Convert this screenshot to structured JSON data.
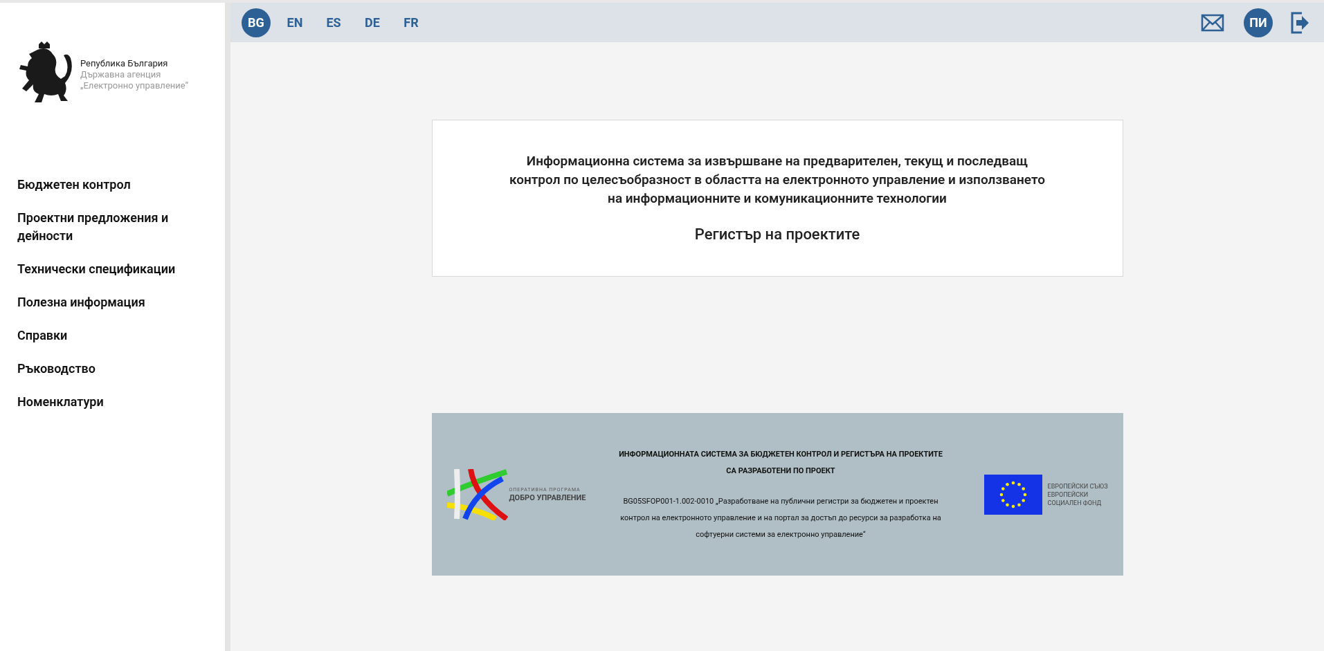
{
  "logo": {
    "line_1": "Република България",
    "line_2": "Държавна агенция",
    "line_3": "„Електронно управление“"
  },
  "sidebar": {
    "items": [
      {
        "label": "Бюджетен контрол"
      },
      {
        "label": "Проектни предложения и дейности"
      },
      {
        "label": "Технически спецификации"
      },
      {
        "label": "Полезна информация"
      },
      {
        "label": "Справки"
      },
      {
        "label": "Ръководство"
      },
      {
        "label": "Номенклатури"
      }
    ]
  },
  "languages": [
    {
      "label": "BG",
      "selected": true
    },
    {
      "label": "EN",
      "selected": false
    },
    {
      "label": "ES",
      "selected": false
    },
    {
      "label": "DE",
      "selected": false
    },
    {
      "label": "FR",
      "selected": false
    }
  ],
  "user": {
    "initials": "ПИ"
  },
  "intro": {
    "description": "Информационна система за извършване на предварителен, текущ и последващ контрол по целесъобразност в областта на електронното управление и използването на информационните и комуникационните технологии",
    "title": "Регистър на проектите"
  },
  "banner": {
    "program_caption": "ОПЕРАТИВНА ПРОГРАМА",
    "program_name": "ДОБРО УПРАВЛЕНИЕ",
    "heading_1": "ИНФОРМАЦИОННАТА СИСТЕМА ЗА БЮДЖЕТЕН КОНТРОЛ И РЕГИСТЪРА НА ПРОЕКТИТЕ",
    "heading_2": "СА РАЗРАБОТЕНИ ПО ПРОЕКТ",
    "project": "BG05SFOP001-1.002-0010 „Разработване на публични регистри за бюджетен и проектен контрол на електронното управление и на портал за достъп до ресурси за разработка на софтуерни системи за електронно управление“",
    "eu_lines": [
      "ЕВРОПЕЙСКИ СЪЮЗ",
      "ЕВРОПЕЙСКИ",
      "СОЦИАЛЕН ФОНД"
    ]
  }
}
